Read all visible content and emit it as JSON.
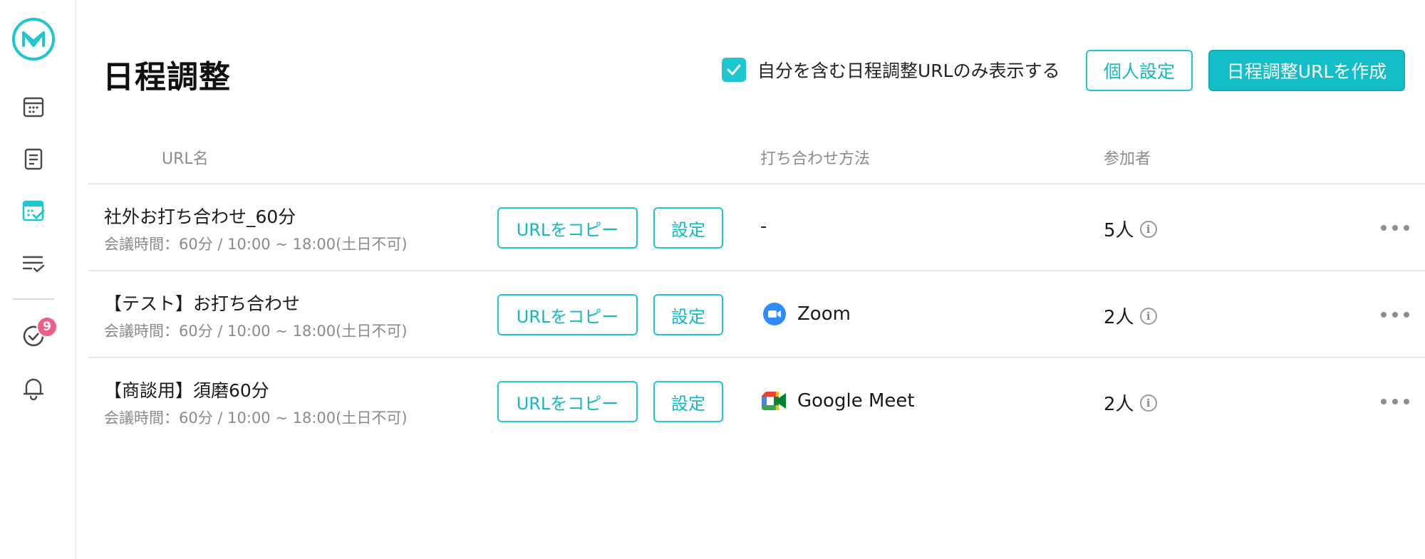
{
  "sidebar": {
    "items": [
      {
        "icon": "calendar-icon"
      },
      {
        "icon": "document-icon"
      },
      {
        "icon": "schedule-check-icon",
        "active": true
      },
      {
        "icon": "task-list-icon"
      },
      {
        "icon": "check-circle-icon",
        "badge": "9"
      },
      {
        "icon": "bell-icon"
      }
    ]
  },
  "header": {
    "title": "日程調整",
    "filter_label": "自分を含む日程調整URLのみ表示する",
    "filter_checked": true,
    "personal_settings_label": "個人設定",
    "create_label": "日程調整URLを作成"
  },
  "table": {
    "columns": [
      "URL名",
      "打ち合わせ方法",
      "参加者"
    ],
    "rows": [
      {
        "name": "社外お打ち合わせ_60分",
        "details": "会議時間：60分 / 10:00 ~ 18:00(土日不可)",
        "copy_label": "URLをコピー",
        "settings_label": "設定",
        "method": "-",
        "method_icon": "",
        "participants": "5人"
      },
      {
        "name": "【テスト】お打ち合わせ",
        "details": "会議時間：60分 / 10:00 ~ 18:00(土日不可)",
        "copy_label": "URLをコピー",
        "settings_label": "設定",
        "method": "Zoom",
        "method_icon": "zoom-icon",
        "participants": "2人"
      },
      {
        "name": "【商談用】須磨60分",
        "details": "会議時間：60分 / 10:00 ~ 18:00(土日不可)",
        "copy_label": "URLをコピー",
        "settings_label": "設定",
        "method": "Google Meet",
        "method_icon": "google-meet-icon",
        "participants": "2人"
      }
    ]
  },
  "colors": {
    "accent": "#1ec6cf",
    "badge": "#ef5f85",
    "zoom": "#2d8cff"
  }
}
